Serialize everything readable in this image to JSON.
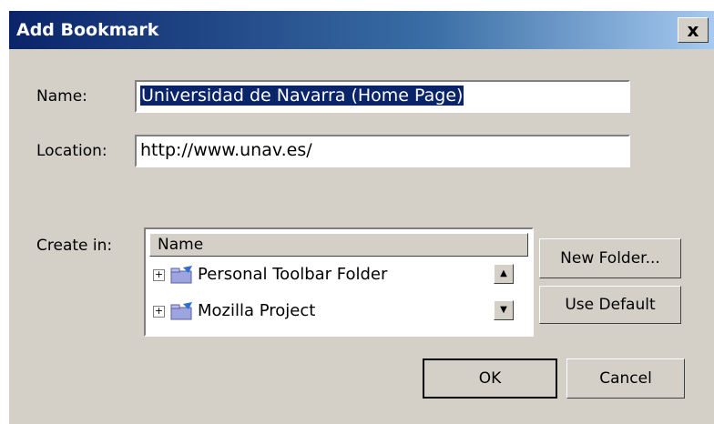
{
  "dialog": {
    "title": "Add Bookmark",
    "close_label": "x"
  },
  "name_field": {
    "label": "Name:",
    "value": "Universidad de Navarra (Home Page)"
  },
  "location_field": {
    "label": "Location:",
    "value": "http://www.unav.es/"
  },
  "create_in": {
    "label": "Create in:",
    "column_header": "Name",
    "items": [
      {
        "label": "Personal Toolbar Folder",
        "icon": "folder-icon"
      },
      {
        "label": "Mozilla Project",
        "icon": "folder-icon"
      }
    ]
  },
  "buttons": {
    "new_folder": "New Folder...",
    "use_default": "Use Default",
    "ok": "OK",
    "cancel": "Cancel"
  }
}
